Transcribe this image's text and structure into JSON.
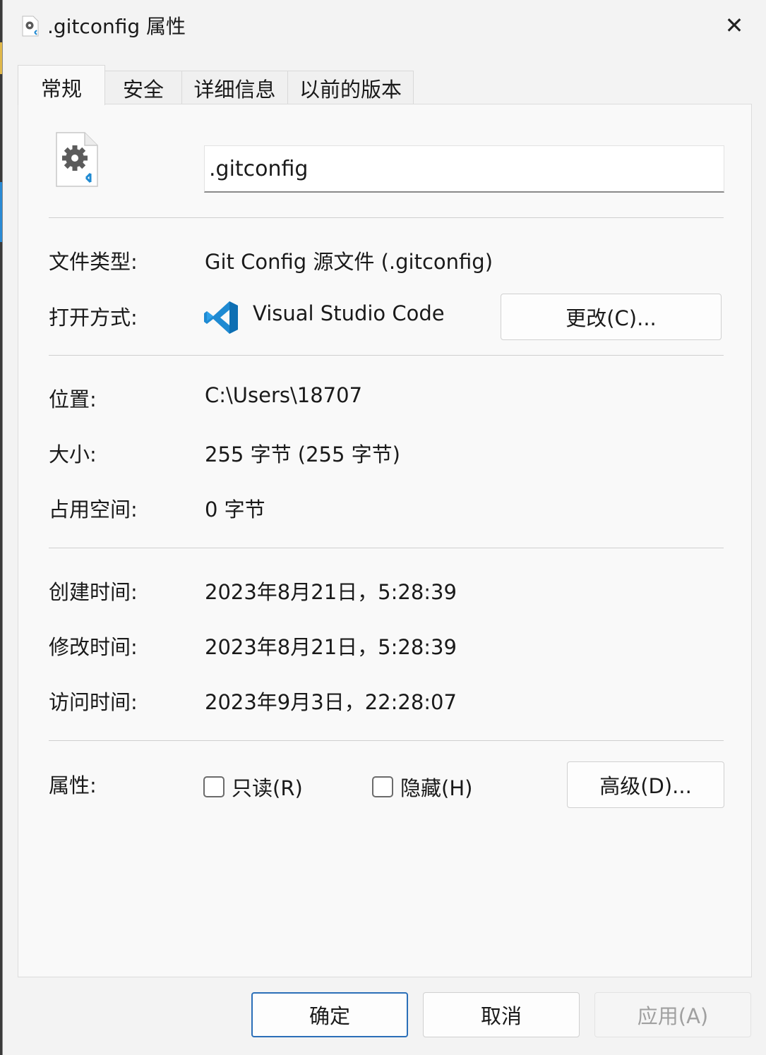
{
  "window": {
    "title": ".gitconfig 属性",
    "close_glyph": "✕"
  },
  "tabs": [
    {
      "label": "常规",
      "active": true
    },
    {
      "label": "安全",
      "active": false
    },
    {
      "label": "详细信息",
      "active": false
    },
    {
      "label": "以前的版本",
      "active": false
    }
  ],
  "general": {
    "file_name": ".gitconfig",
    "file_icon": "config-file-gear-icon",
    "file_type_label": "文件类型:",
    "file_type_value": "Git Config 源文件 (.gitconfig)",
    "open_with_label": "打开方式:",
    "open_with_app": "Visual Studio Code",
    "open_with_icon": "vscode-icon",
    "change_button": "更改(C)...",
    "location_label": "位置:",
    "location_value": "C:\\Users\\18707",
    "size_label": "大小:",
    "size_value": "255 字节 (255 字节)",
    "disk_size_label": "占用空间:",
    "disk_size_value": "0 字节",
    "created_label": "创建时间:",
    "created_value": "2023年8月21日，5:28:39",
    "modified_label": "修改时间:",
    "modified_value": "2023年8月21日，5:28:39",
    "accessed_label": "访问时间:",
    "accessed_value": "2023年9月3日，22:28:07",
    "attributes_label": "属性:",
    "readonly_label": "只读(R)",
    "readonly_checked": false,
    "hidden_label": "隐藏(H)",
    "hidden_checked": false,
    "advanced_button": "高级(D)..."
  },
  "footer": {
    "ok": "确定",
    "cancel": "取消",
    "apply": "应用(A)",
    "apply_enabled": false
  },
  "colors": {
    "accent": "#2b6fb8",
    "vscode_blue": "#1f8ad2"
  }
}
